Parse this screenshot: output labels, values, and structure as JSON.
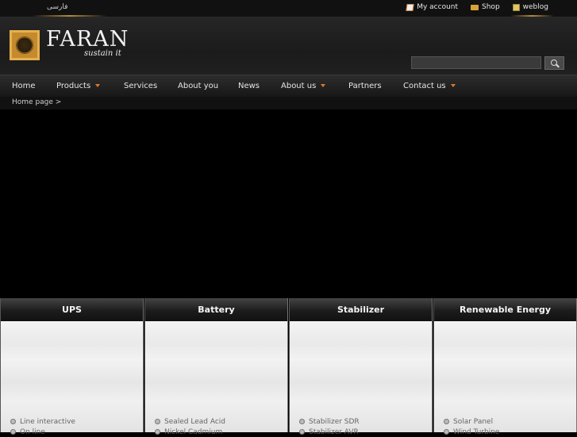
{
  "topbar": {
    "language_link": "فارسی",
    "links": [
      {
        "label": "My account",
        "icon": "account-icon"
      },
      {
        "label": "Shop",
        "icon": "shop-icon"
      },
      {
        "label": "weblog",
        "icon": "weblog-icon"
      }
    ]
  },
  "header": {
    "brand": "FARAN",
    "tagline": "sustain it",
    "search": {
      "placeholder": ""
    }
  },
  "nav": {
    "items": [
      {
        "label": "Home"
      },
      {
        "label": "Products"
      },
      {
        "label": "Services"
      },
      {
        "label": "About you"
      },
      {
        "label": "News"
      },
      {
        "label": "About us"
      },
      {
        "label": "Partners"
      },
      {
        "label": "Contact us"
      }
    ]
  },
  "breadcrumb": "Home page >",
  "categories": [
    {
      "title": "UPS",
      "items": [
        "Line interactive",
        "On line"
      ]
    },
    {
      "title": "Battery",
      "items": [
        "Sealed Lead Acid",
        "Nickel Cadmium"
      ]
    },
    {
      "title": "Stabilizer",
      "items": [
        "Stabilizer SDR",
        "Stabilizer AVR"
      ]
    },
    {
      "title": "Renewable Energy",
      "items": [
        "Solar Panel",
        "Wind Turbine"
      ]
    }
  ],
  "colors": {
    "accent": "#e3762b",
    "gold": "#c48a2c"
  }
}
